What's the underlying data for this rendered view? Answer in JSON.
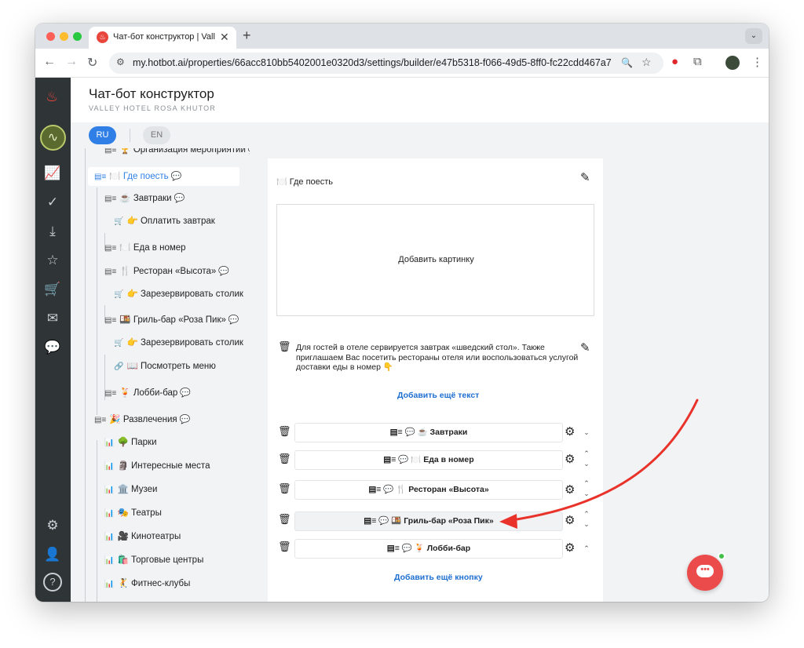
{
  "browser": {
    "tab_title": "Чат-бот конструктор | Valley",
    "close_glyph": "✕",
    "newtab_glyph": "+",
    "tabmenu_glyph": "⌄",
    "url": "my.hotbot.ai/properties/66acc810bb5402001e0320d3/settings/builder/e47b5318-f066-49d5-8ff0-fc22cdd467a7",
    "back_glyph": "←",
    "forward_glyph": "→",
    "reload_glyph": "↻",
    "site_info_glyph": "⚙",
    "zoom_glyph": "🔍",
    "star_glyph": "☆",
    "menu_glyph": "⋮",
    "traffic_colors": [
      "#fe5f57",
      "#febc2e",
      "#28c840"
    ]
  },
  "app": {
    "title": "Чат-бот конструктор",
    "subtitle": "VALLEY HOTEL ROSA KHUTOR",
    "langs": [
      {
        "label": "RU",
        "active": true
      },
      {
        "label": "EN",
        "active": false
      }
    ]
  },
  "rail": {
    "logo_glyph": "♨",
    "avatar_glyph": "∿",
    "icons": [
      "📈",
      "✓",
      "⤓",
      "☆",
      "🛒",
      "✉",
      "💬",
      "⚙",
      "👤",
      "?"
    ]
  },
  "tree": {
    "items": [
      {
        "label": "Организация мероприятий",
        "prefix": "🏆",
        "icon": "▤≡",
        "bubble": true
      },
      {
        "label": "Где поесть",
        "prefix": "🍽️",
        "icon": "▤≡",
        "bubble": true
      },
      {
        "label": "Завтраки",
        "prefix": "☕",
        "icon": "▤≡",
        "bubble": true
      },
      {
        "label": "Оплатить завтрак",
        "prefix": "👉",
        "icon": "🛒",
        "bubble": false
      },
      {
        "label": "Еда в номер",
        "prefix": "🍽️",
        "icon": "▤≡",
        "bubble": false
      },
      {
        "label": "Ресторан «Высота»",
        "prefix": "🍴",
        "icon": "▤≡",
        "bubble": true
      },
      {
        "label": "Зарезервировать столик",
        "prefix": "👉",
        "icon": "🛒",
        "bubble": false
      },
      {
        "label": "Гриль-бар «Роза Пик»",
        "prefix": "🍱",
        "icon": "▤≡",
        "bubble": true
      },
      {
        "label": "Зарезервировать столик",
        "prefix": "👉",
        "icon": "🛒",
        "bubble": false
      },
      {
        "label": "Посмотреть меню",
        "prefix": "📖",
        "icon": "🔗",
        "bubble": false
      },
      {
        "label": "Лобби-бар",
        "prefix": "🍹",
        "icon": "▤≡",
        "bubble": true
      },
      {
        "label": "Развлечения",
        "prefix": "🎉",
        "icon": "▤≡",
        "bubble": true
      },
      {
        "label": "Парки",
        "prefix": "🌳",
        "icon": "📊",
        "bubble": false
      },
      {
        "label": "Интересные места",
        "prefix": "🗿",
        "icon": "📊",
        "bubble": false
      },
      {
        "label": "Музеи",
        "prefix": "🏛️",
        "icon": "📊",
        "bubble": false
      },
      {
        "label": "Театры",
        "prefix": "🎭",
        "icon": "📊",
        "bubble": false
      },
      {
        "label": "Кинотеатры",
        "prefix": "🎥",
        "icon": "📊",
        "bubble": false
      },
      {
        "label": "Торговые центры",
        "prefix": "🛍️",
        "icon": "📊",
        "bubble": false
      },
      {
        "label": "Фитнес-клубы",
        "prefix": "🤾",
        "icon": "📊",
        "bubble": false
      }
    ]
  },
  "editor": {
    "title": "🍽️ Где поесть",
    "add_image": "Добавить картинку",
    "text": "Для гостей в отеле сервируется завтрак «шведский стол». Также приглашаем Вас посетить рестораны отеля или воспользоваться услугой доставки еды в номер 👇",
    "add_text": "Добавить ещё текст",
    "add_button": "Добавить ещё кнопку",
    "edit_glyph": "✎",
    "trash_glyph": "🗑",
    "gear_glyph": "⚙",
    "up_glyph": "⌃",
    "down_glyph": "⌄",
    "buttons": [
      {
        "label": "▤≡  💬  ☕ Завтраки"
      },
      {
        "label": "▤≡  💬  🍽️ Еда в номер"
      },
      {
        "label": "▤≡  💬  🍴 Ресторан «Высота»"
      },
      {
        "label": "▤≡  💬  🍱 Гриль-бар «Роза Пик»"
      },
      {
        "label": "▤≡  💬  🍹 Лобби-бар"
      }
    ]
  },
  "chat_widget": {
    "dots": "•••"
  },
  "colors": {
    "accent": "#2f7fe6",
    "annotation_arrow": "#e8322a",
    "chat_bubble": "#ec4b4b",
    "rail": "#2f3437"
  }
}
